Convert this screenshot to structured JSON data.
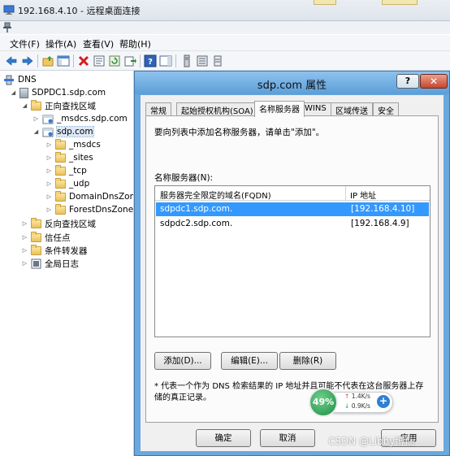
{
  "window": {
    "title": "192.168.4.10 - 远程桌面连接"
  },
  "menu": [
    "文件(F)",
    "操作(A)",
    "查看(V)",
    "帮助(H)"
  ],
  "tree": {
    "root": "DNS",
    "server": "SDPDC1.sdp.com",
    "forward_zones": "正向查找区域",
    "msdcs_zone": "_msdcs.sdp.com",
    "sdp_zone": "sdp.com",
    "children": [
      "_msdcs",
      "_sites",
      "_tcp",
      "_udp",
      "DomainDnsZones",
      "ForestDnsZones"
    ],
    "reverse_zones": "反向查找区域",
    "trust_points": "信任点",
    "conditional_forwarders": "条件转发器",
    "global_logs": "全局日志"
  },
  "dialog": {
    "title": "sdp.com 属性",
    "help": "?",
    "close": "✕",
    "tabs": [
      "常规",
      "起始授权机构(SOA)",
      "名称服务器",
      "WINS",
      "区域传送",
      "安全"
    ],
    "description": "要向列表中添加名称服务器，请单击\"添加\"。",
    "list_label": "名称服务器(N):",
    "columns": [
      "服务器完全限定的域名(FQDN)",
      "IP 地址"
    ],
    "rows": [
      {
        "fqdn": "sdpdc1.sdp.com.",
        "ip": "[192.168.4.10]"
      },
      {
        "fqdn": "sdpdc2.sdp.com.",
        "ip": "[192.168.4.9]"
      }
    ],
    "add": "添加(D)...",
    "edit": "编辑(E)...",
    "delete": "删除(R)",
    "note": "* 代表一个作为 DNS 检索结果的 IP 地址并且可能不代表在这台服务器上存储的真正记录。",
    "ok": "确定",
    "cancel": "取消",
    "apply": "应用"
  },
  "network_widget": {
    "percent": "49%",
    "up": "1.4K/s",
    "down": "0.9K/s",
    "plus": "+"
  },
  "watermark": "CSDN @Libby博仙"
}
